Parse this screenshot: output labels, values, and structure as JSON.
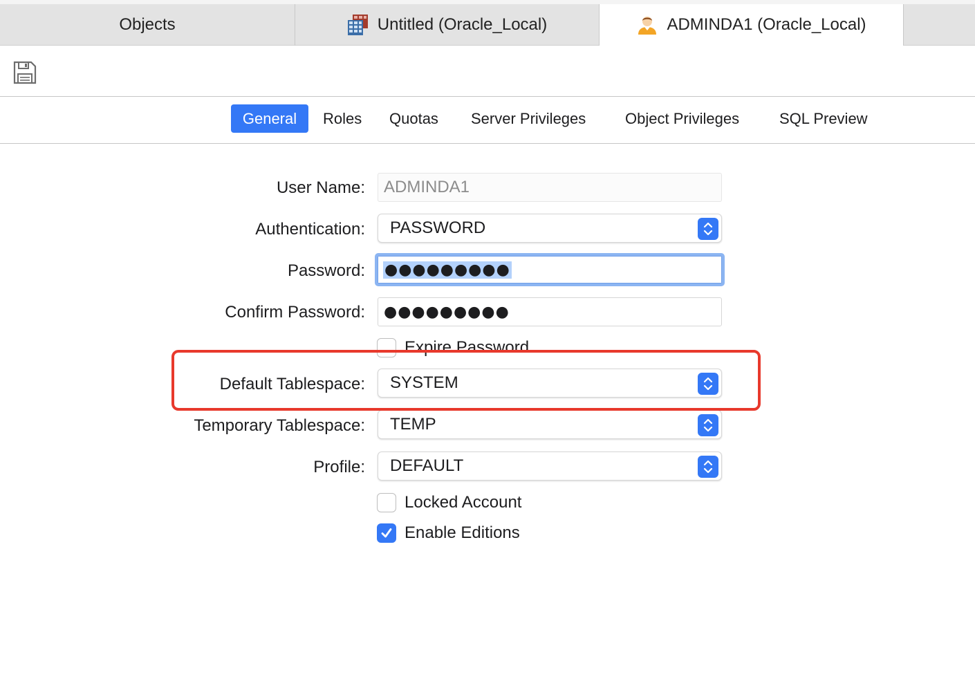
{
  "tabs": [
    {
      "label": "Objects"
    },
    {
      "label": "Untitled (Oracle_Local)",
      "icon": "table-grid-icon"
    },
    {
      "label": "ADMINDA1 (Oracle_Local)",
      "icon": "user-icon"
    }
  ],
  "toolbar": {
    "save_icon": "floppy-disk-icon"
  },
  "segments": [
    {
      "label": "General"
    },
    {
      "label": "Roles"
    },
    {
      "label": "Quotas"
    },
    {
      "label": "Server Privileges"
    },
    {
      "label": "Object Privileges"
    },
    {
      "label": "SQL Preview"
    }
  ],
  "form": {
    "user_name_label": "User Name:",
    "user_name_value": "ADMINDA1",
    "authentication_label": "Authentication:",
    "authentication_value": "PASSWORD",
    "password_label": "Password:",
    "password_value": "●●●●●●●●●",
    "confirm_password_label": "Confirm Password:",
    "confirm_password_value": "●●●●●●●●●",
    "expire_password_label": "Expire Password",
    "default_tablespace_label": "Default Tablespace:",
    "default_tablespace_value": "SYSTEM",
    "temporary_tablespace_label": "Temporary Tablespace:",
    "temporary_tablespace_value": "TEMP",
    "profile_label": "Profile:",
    "profile_value": "DEFAULT",
    "locked_account_label": "Locked Account",
    "enable_editions_label": "Enable Editions"
  },
  "colors": {
    "accent": "#3478f6",
    "highlight": "#e8392c"
  }
}
